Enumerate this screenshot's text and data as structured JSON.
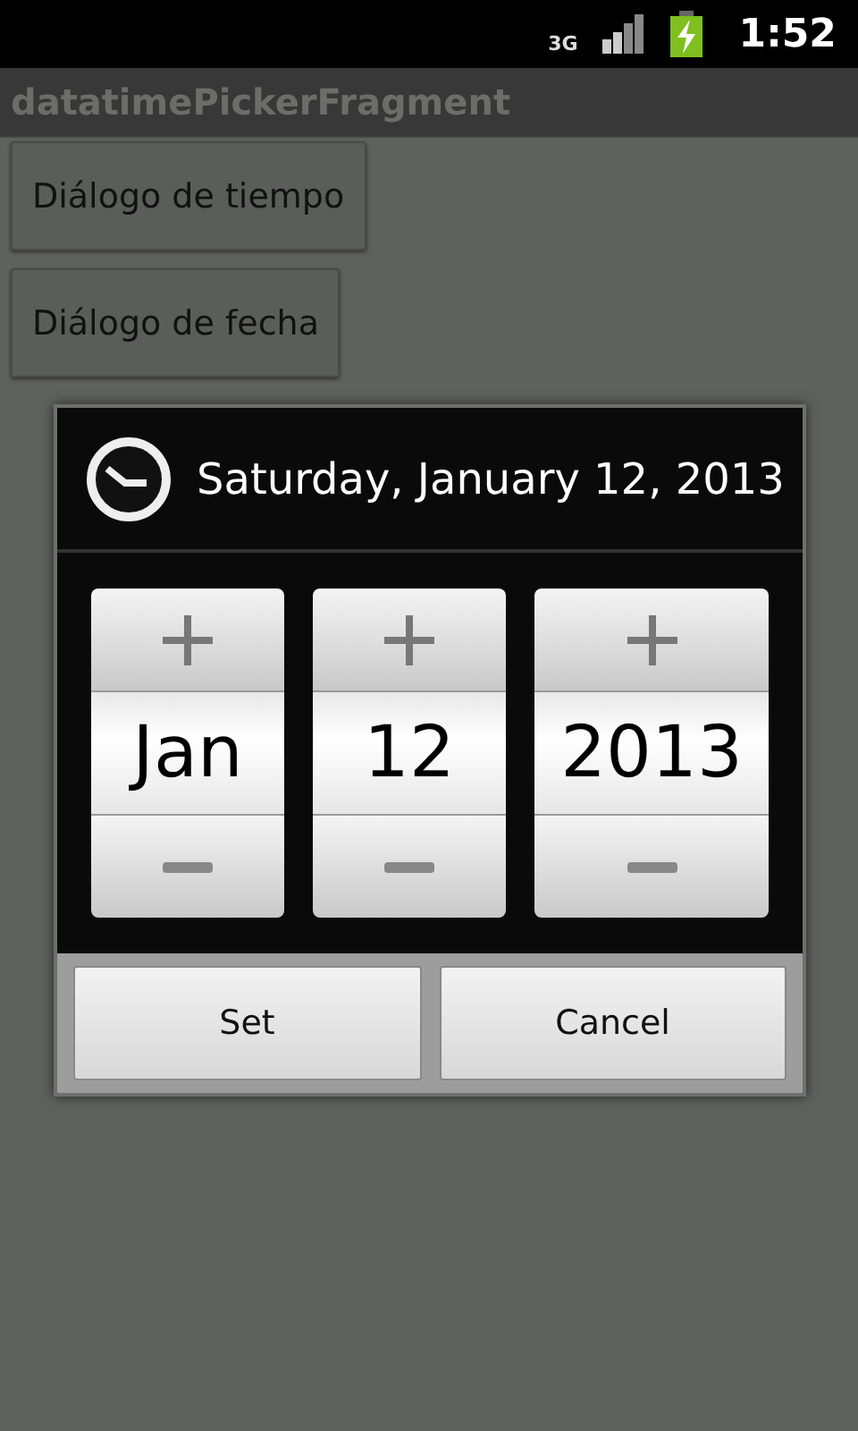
{
  "status_bar": {
    "network_type": "3G",
    "time": "1:52"
  },
  "app_bar": {
    "title": "datatimePickerFragment"
  },
  "buttons": [
    "Diálogo de tiempo",
    "Diálogo de fecha"
  ],
  "dialog": {
    "title": "Saturday, January 12, 2013",
    "spinners": [
      {
        "value": "Jan"
      },
      {
        "value": "12"
      },
      {
        "value": "2013"
      }
    ],
    "buttons": [
      "Set",
      "Cancel"
    ]
  }
}
